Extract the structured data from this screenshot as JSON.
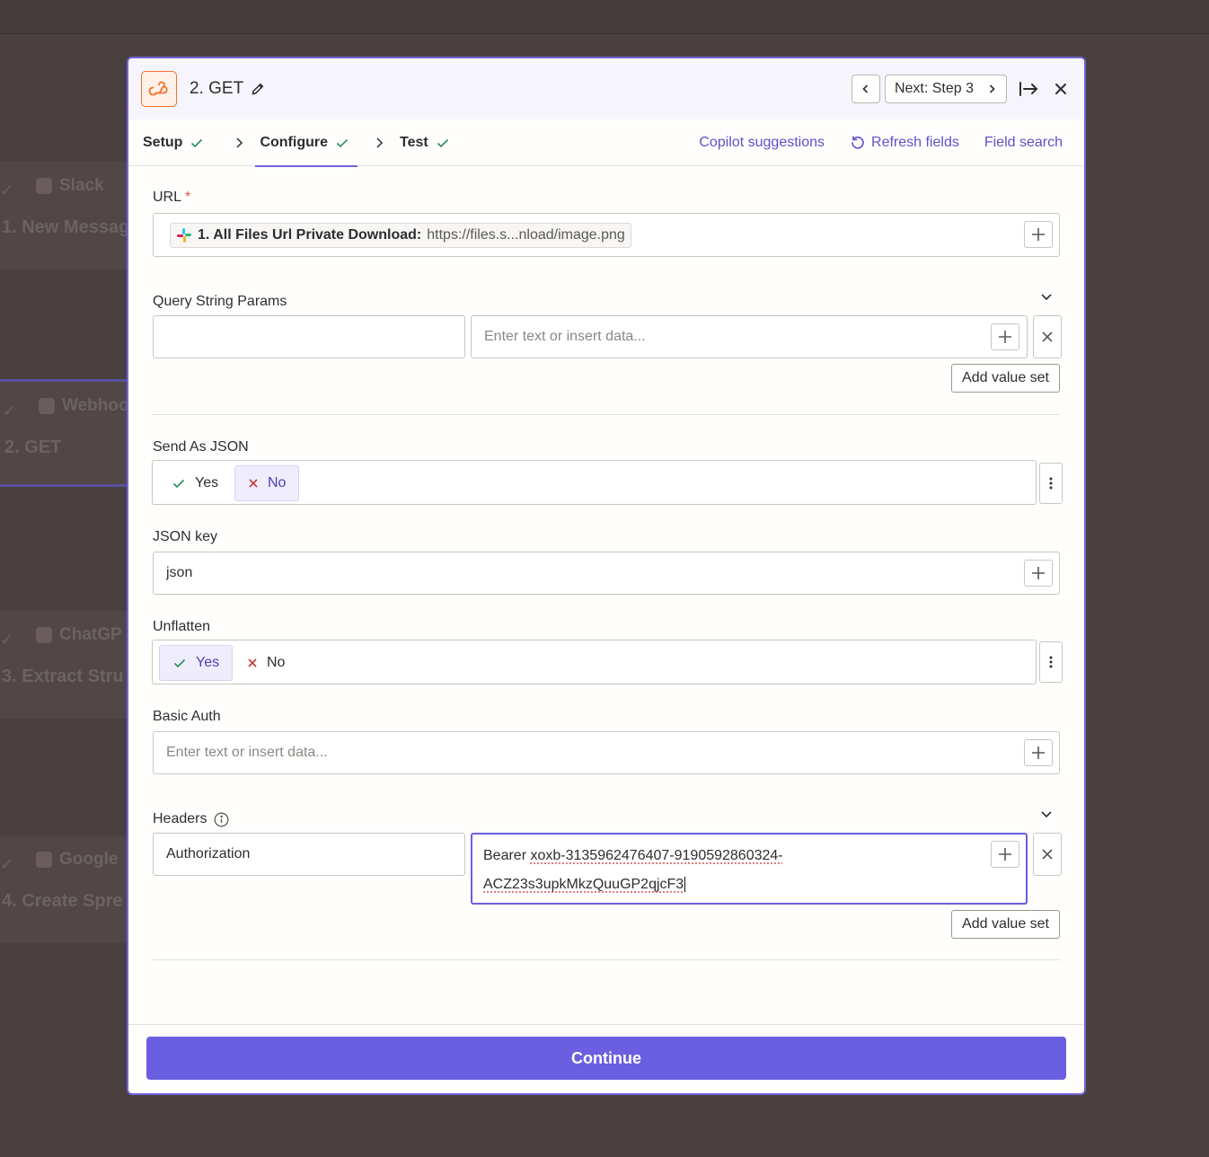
{
  "background": {
    "cards": [
      {
        "app": "Slack",
        "title": "1. New Messag"
      },
      {
        "app": "Webhoo",
        "title": "2. GET"
      },
      {
        "app": "ChatGP",
        "title": "3. Extract Stru"
      },
      {
        "app": "Google",
        "title": "4. Create Spre"
      }
    ]
  },
  "header": {
    "title": "2. GET",
    "next_label": "Next: Step 3"
  },
  "tabs": [
    {
      "label": "Setup"
    },
    {
      "label": "Configure"
    },
    {
      "label": "Test"
    }
  ],
  "tab_links": {
    "copilot": "Copilot suggestions",
    "refresh": "Refresh fields",
    "field_search": "Field search"
  },
  "fields": {
    "url": {
      "label": "URL",
      "required_mark": "*",
      "chip_label": "1. All Files Url Private Download:",
      "chip_value": "https://files.s...nload/image.png"
    },
    "query": {
      "label": "Query String Params",
      "key_value": "",
      "value_placeholder": "Enter text or insert data...",
      "add_label": "Add value set"
    },
    "send_json": {
      "label": "Send As JSON",
      "yes": "Yes",
      "no": "No",
      "selected": "No"
    },
    "json_key": {
      "label": "JSON key",
      "value": "json"
    },
    "unflatten": {
      "label": "Unflatten",
      "yes": "Yes",
      "no": "No",
      "selected": "Yes"
    },
    "basic_auth": {
      "label": "Basic Auth",
      "placeholder": "Enter text or insert data..."
    },
    "headers": {
      "label": "Headers",
      "key_value": "Authorization",
      "value_prefix": "Bearer",
      "value_line1": "xoxb-3135962476407-9190592860324-",
      "value_line2": "ACZ23s3upkMkzQuuGP2qjcF3",
      "add_label": "Add value set"
    }
  },
  "footer": {
    "continue_label": "Continue"
  },
  "colors": {
    "accent": "#6a5fe0",
    "check_green": "#2e8a5b",
    "x_red": "#c23a3a",
    "webhook_orange": "#f2712f"
  }
}
